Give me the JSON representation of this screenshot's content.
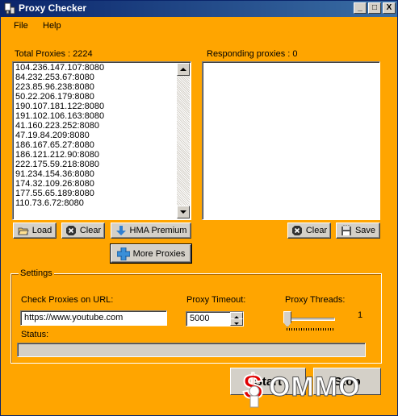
{
  "window": {
    "title": "Proxy Checker",
    "controls": {
      "minimize": "_",
      "maximize": "□",
      "close": "X"
    }
  },
  "menu": [
    "File",
    "Help"
  ],
  "total": {
    "label": "Total Proxies : 2224",
    "items": [
      "104.236.147.107:8080",
      "84.232.253.67:8080",
      "223.85.96.238:8080",
      "50.22.206.179:8080",
      "190.107.181.122:8080",
      "191.102.106.163:8080",
      "41.160.223.252:8080",
      "47.19.84.209:8080",
      "186.167.65.27:8080",
      "186.121.212.90:8080",
      "222.175.59.218:8080",
      "91.234.154.36:8080",
      "174.32.109.26:8080",
      "177.55.65.189:8080",
      "110.73.6.72:8080"
    ]
  },
  "responding": {
    "label": "Responding proxies : 0",
    "items": []
  },
  "buttons": {
    "load": "Load",
    "clear_left": "Clear",
    "hma": "HMA Premium",
    "more": "More Proxies",
    "clear_right": "Clear",
    "save": "Save",
    "start": "Start",
    "stop": "Stop"
  },
  "settings": {
    "title": "Settings",
    "url_label": "Check Proxies on URL:",
    "url_value": "https://www.youtube.com",
    "timeout_label": "Proxy Timeout:",
    "timeout_value": "5000",
    "threads_label": "Proxy Threads:",
    "threads_value": "1",
    "status_label": "Status:",
    "progress": 0
  },
  "watermark": {
    "text": "SOMMO"
  },
  "icons": {
    "load": "folder-open-icon",
    "clear": "clear-stop-icon",
    "hma": "download-arrow-icon",
    "more": "plus-icon",
    "save": "save-icon"
  },
  "colors": {
    "background": "#ffa500",
    "titlebar": "#0a246a",
    "button_face": "#d4d0c8",
    "watermark": "#e00000"
  }
}
